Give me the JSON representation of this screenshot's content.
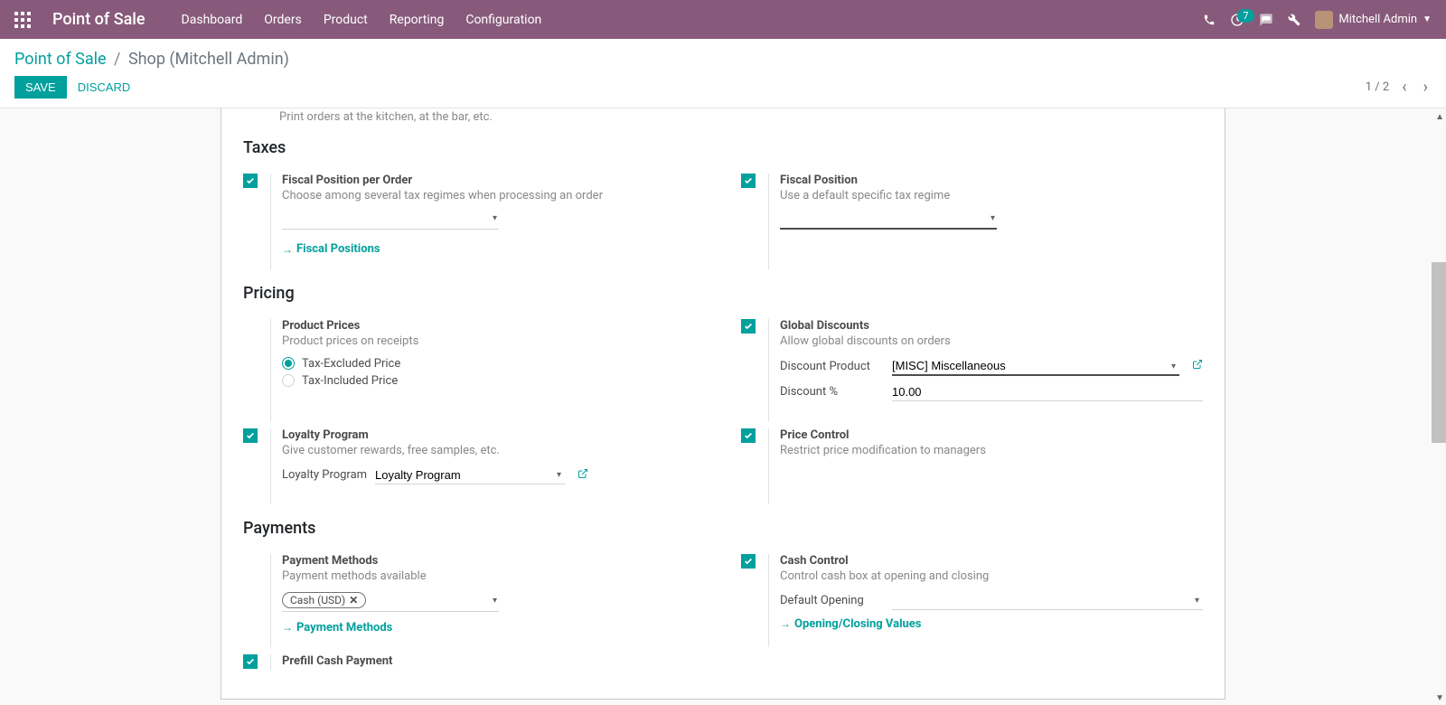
{
  "navbar": {
    "brand": "Point of Sale",
    "menu": [
      "Dashboard",
      "Orders",
      "Product",
      "Reporting",
      "Configuration"
    ],
    "badge": "7",
    "user": "Mitchell Admin"
  },
  "breadcrumb": {
    "root": "Point of Sale",
    "current": "Shop (Mitchell Admin)"
  },
  "buttons": {
    "save": "SAVE",
    "discard": "DISCARD"
  },
  "pager": "1 / 2",
  "faded_top": "Print orders at the kitchen, at the bar, etc.",
  "sections": {
    "taxes": "Taxes",
    "pricing": "Pricing",
    "payments": "Payments"
  },
  "taxes": {
    "fiscal_per_order": {
      "title": "Fiscal Position per Order",
      "desc": "Choose among several tax regimes when processing an order",
      "link": "Fiscal Positions"
    },
    "fiscal_position": {
      "title": "Fiscal Position",
      "desc": "Use a default specific tax regime"
    }
  },
  "pricing": {
    "product_prices": {
      "title": "Product Prices",
      "desc": "Product prices on receipts",
      "opt1": "Tax-Excluded Price",
      "opt2": "Tax-Included Price"
    },
    "global_discounts": {
      "title": "Global Discounts",
      "desc": "Allow global discounts on orders",
      "label_product": "Discount Product",
      "value_product": "[MISC] Miscellaneous",
      "label_pct": "Discount %",
      "value_pct": "10.00"
    },
    "loyalty": {
      "title": "Loyalty Program",
      "desc": "Give customer rewards, free samples, etc.",
      "label": "Loyalty Program",
      "value": "Loyalty Program"
    },
    "price_control": {
      "title": "Price Control",
      "desc": "Restrict price modification to managers"
    }
  },
  "payments": {
    "methods": {
      "title": "Payment Methods",
      "desc": "Payment methods available",
      "tag": "Cash (USD)",
      "link": "Payment Methods"
    },
    "cash_control": {
      "title": "Cash Control",
      "desc": "Control cash box at opening and closing",
      "label_opening": "Default Opening",
      "link": "Opening/Closing Values"
    },
    "prefill": {
      "title": "Prefill Cash Payment"
    }
  }
}
